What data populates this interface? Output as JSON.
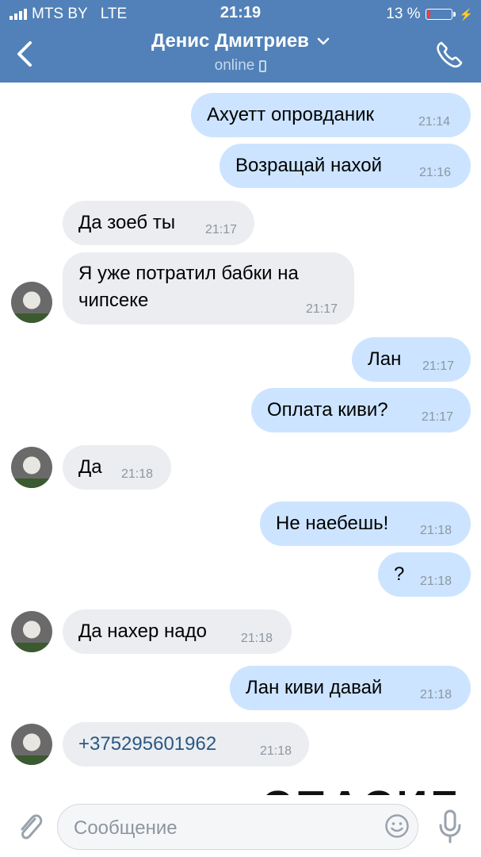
{
  "status_bar": {
    "carrier": "MTS BY",
    "network": "LTE",
    "time": "21:19",
    "battery": "13 %",
    "battery_level": 0.13
  },
  "header": {
    "title": "Денис Дмитриев",
    "subtitle": "online"
  },
  "messages": [
    {
      "direction": "out",
      "text": "Ахуетт опровданик",
      "time": "21:14"
    },
    {
      "direction": "out",
      "text": "Возращай нахой",
      "time": "21:16"
    },
    {
      "direction": "in",
      "text": "Да зоеб ты",
      "time": "21:17"
    },
    {
      "direction": "in",
      "text": "Я уже потратил бабки на чипсеке",
      "time": "21:17"
    },
    {
      "direction": "out",
      "text": "Лан",
      "time": "21:17"
    },
    {
      "direction": "out",
      "text": "Оплата киви?",
      "time": "21:17"
    },
    {
      "direction": "in",
      "text": "Да",
      "time": "21:18"
    },
    {
      "direction": "out",
      "text": "Не наебешь!",
      "time": "21:18"
    },
    {
      "direction": "out",
      "text": "?",
      "time": "21:18"
    },
    {
      "direction": "in",
      "text": "Да нахер надо",
      "time": "21:18"
    },
    {
      "direction": "out",
      "text": "Лан киви давай",
      "time": "21:18"
    },
    {
      "direction": "in",
      "text": "+375295601962",
      "time": "21:18"
    }
  ],
  "sticker_text": "СПАСИБО",
  "composer": {
    "placeholder": "Сообщение"
  },
  "colors": {
    "header": "#5181b8",
    "outgoing_bubble": "#cce4ff",
    "incoming_bubble": "#ebedf0",
    "link": "#2a5885"
  }
}
